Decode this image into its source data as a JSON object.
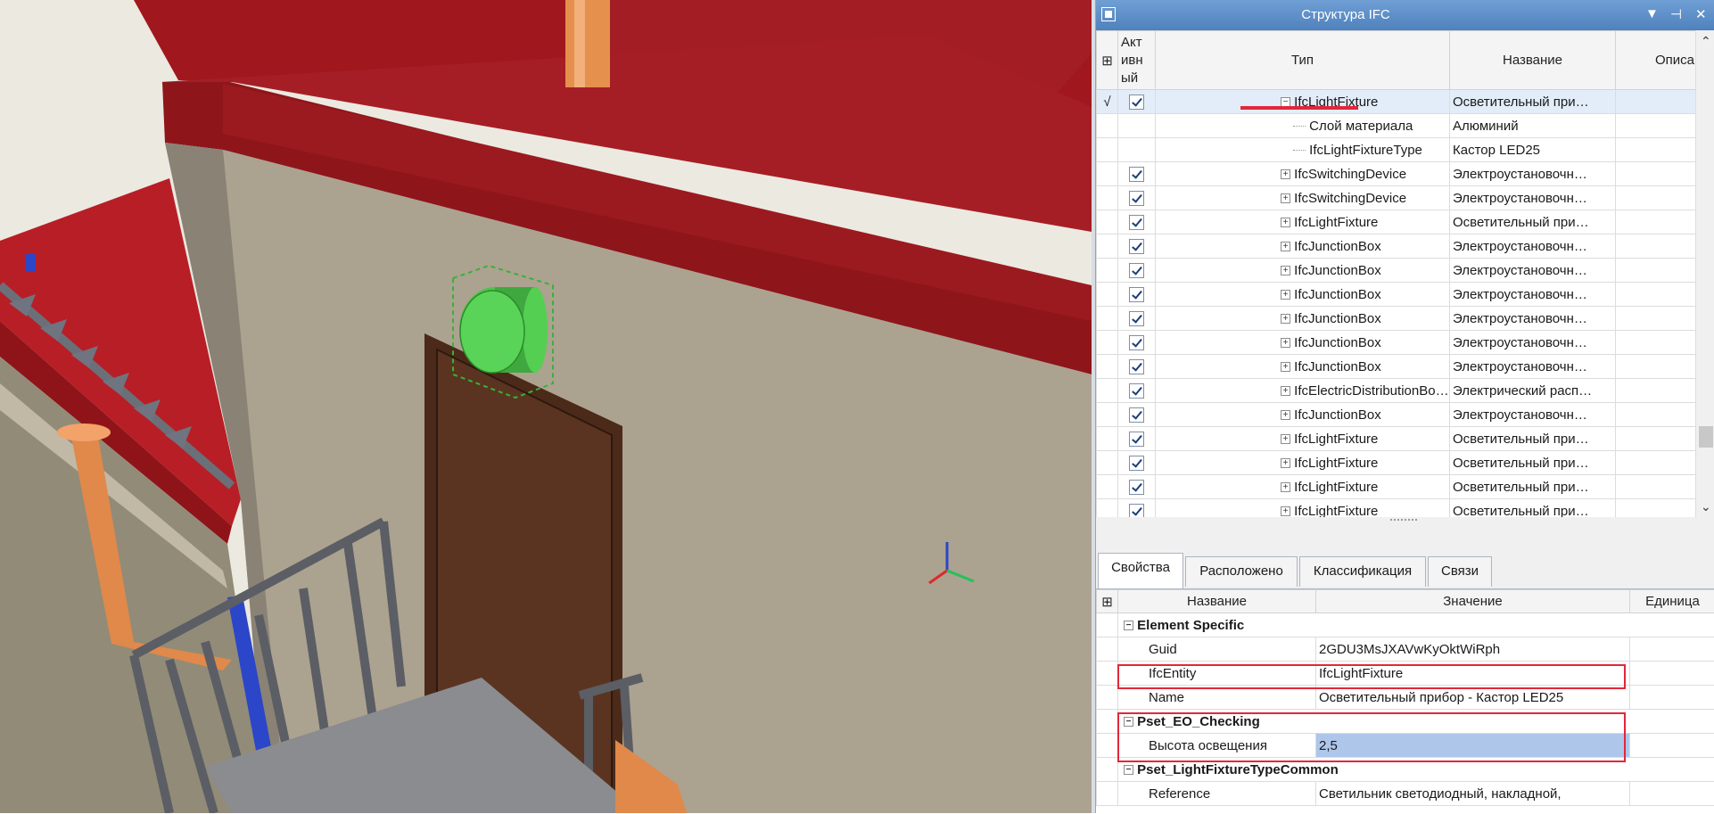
{
  "ifc_panel": {
    "title": "Структура IFC",
    "columns": {
      "active": "Активный",
      "active_lines": [
        "Акт",
        "ивн",
        "ый"
      ],
      "type": "Тип",
      "name": "Название",
      "desc": "Описа"
    },
    "rows": [
      {
        "mark": "√",
        "checked": true,
        "expander": "−",
        "indent": 1,
        "type": "IfcLightFixture",
        "name": "Осветительный при…",
        "selected": true
      },
      {
        "mark": "",
        "checked": false,
        "expander": "",
        "indent": 2,
        "type": "Слой материала",
        "name": "Алюминий",
        "selected": false
      },
      {
        "mark": "",
        "checked": false,
        "expander": "",
        "indent": 2,
        "type": "IfcLightFixtureType",
        "name": "Кастор LED25",
        "selected": false
      },
      {
        "mark": "",
        "checked": true,
        "expander": "+",
        "indent": 1,
        "type": "IfcSwitchingDevice",
        "name": "Электроустановочн…",
        "selected": false
      },
      {
        "mark": "",
        "checked": true,
        "expander": "+",
        "indent": 1,
        "type": "IfcSwitchingDevice",
        "name": "Электроустановочн…",
        "selected": false
      },
      {
        "mark": "",
        "checked": true,
        "expander": "+",
        "indent": 1,
        "type": "IfcLightFixture",
        "name": "Осветительный при…",
        "selected": false
      },
      {
        "mark": "",
        "checked": true,
        "expander": "+",
        "indent": 1,
        "type": "IfcJunctionBox",
        "name": "Электроустановочн…",
        "selected": false
      },
      {
        "mark": "",
        "checked": true,
        "expander": "+",
        "indent": 1,
        "type": "IfcJunctionBox",
        "name": "Электроустановочн…",
        "selected": false
      },
      {
        "mark": "",
        "checked": true,
        "expander": "+",
        "indent": 1,
        "type": "IfcJunctionBox",
        "name": "Электроустановочн…",
        "selected": false
      },
      {
        "mark": "",
        "checked": true,
        "expander": "+",
        "indent": 1,
        "type": "IfcJunctionBox",
        "name": "Электроустановочн…",
        "selected": false
      },
      {
        "mark": "",
        "checked": true,
        "expander": "+",
        "indent": 1,
        "type": "IfcJunctionBox",
        "name": "Электроустановочн…",
        "selected": false
      },
      {
        "mark": "",
        "checked": true,
        "expander": "+",
        "indent": 1,
        "type": "IfcJunctionBox",
        "name": "Электроустановочн…",
        "selected": false
      },
      {
        "mark": "",
        "checked": true,
        "expander": "+",
        "indent": 1,
        "type": "IfcElectricDistributionBoard",
        "name": "Электрический расп…",
        "selected": false
      },
      {
        "mark": "",
        "checked": true,
        "expander": "+",
        "indent": 1,
        "type": "IfcJunctionBox",
        "name": "Электроустановочн…",
        "selected": false
      },
      {
        "mark": "",
        "checked": true,
        "expander": "+",
        "indent": 1,
        "type": "IfcLightFixture",
        "name": "Осветительный при…",
        "selected": false
      },
      {
        "mark": "",
        "checked": true,
        "expander": "+",
        "indent": 1,
        "type": "IfcLightFixture",
        "name": "Осветительный при…",
        "selected": false
      },
      {
        "mark": "",
        "checked": true,
        "expander": "+",
        "indent": 1,
        "type": "IfcLightFixture",
        "name": "Осветительный при…",
        "selected": false
      },
      {
        "mark": "",
        "checked": true,
        "expander": "+",
        "indent": 1,
        "type": "IfcLightFixture",
        "name": "Осветительный при…",
        "selected": false
      }
    ]
  },
  "tabs": [
    {
      "label": "Свойства",
      "active": true
    },
    {
      "label": "Расположено",
      "active": false
    },
    {
      "label": "Классификация",
      "active": false
    },
    {
      "label": "Связи",
      "active": false
    }
  ],
  "properties": {
    "columns": {
      "name": "Название",
      "value": "Значение",
      "unit": "Единица"
    },
    "rows": [
      {
        "kind": "group",
        "name": "Element Specific",
        "value": ""
      },
      {
        "kind": "prop",
        "name": "Guid",
        "value": "2GDU3MsJXAVwKyOktWiRph"
      },
      {
        "kind": "prop",
        "name": "IfcEntity",
        "value": "IfcLightFixture"
      },
      {
        "kind": "prop",
        "name": "Name",
        "value": "Осветительный прибор - Кастор LED25"
      },
      {
        "kind": "group",
        "name": "Pset_EO_Checking",
        "value": ""
      },
      {
        "kind": "prop",
        "name": "Высота освещения",
        "value": "2,5",
        "selected": true
      },
      {
        "kind": "group",
        "name": "Pset_LightFixtureTypeCommon",
        "value": ""
      },
      {
        "kind": "prop",
        "name": "Reference",
        "value": "Светильник светодиодный, накладной,"
      }
    ]
  },
  "colors": {
    "accent": "#4f81bd",
    "highlight": "#e0283a",
    "selection": "#aec6ea",
    "roof": "#a31e24",
    "fixture": "#4cc44a"
  },
  "icons": {
    "window": "window-icon",
    "dropdown": "triangle-down-icon",
    "pin": "pin-icon",
    "close": "close-icon",
    "column_chooser": "column-chooser-icon"
  }
}
